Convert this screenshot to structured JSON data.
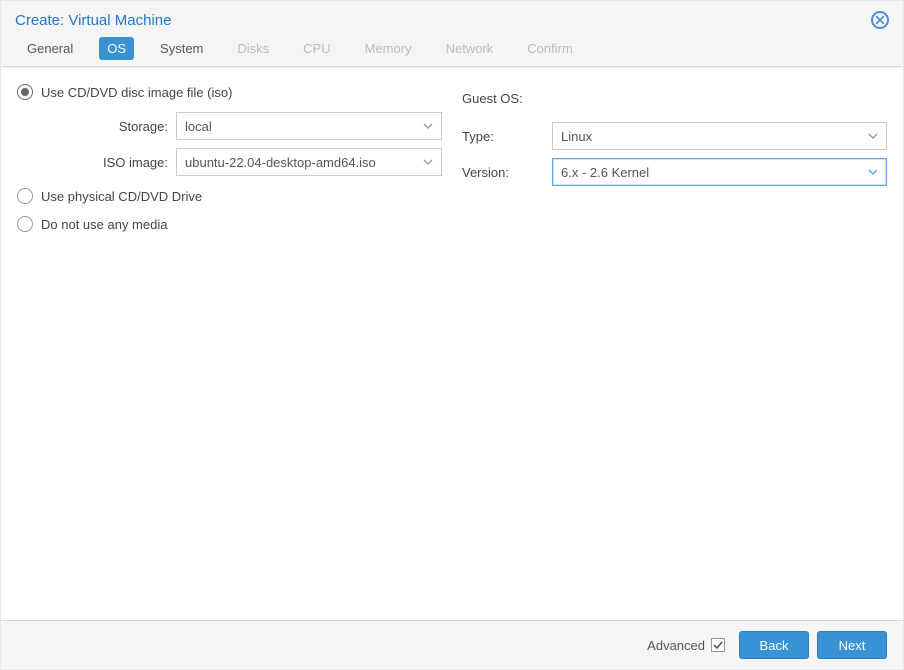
{
  "title": "Create: Virtual Machine",
  "tabs": [
    {
      "label": "General",
      "state": "enabled"
    },
    {
      "label": "OS",
      "state": "active"
    },
    {
      "label": "System",
      "state": "enabled"
    },
    {
      "label": "Disks",
      "state": "disabled"
    },
    {
      "label": "CPU",
      "state": "disabled"
    },
    {
      "label": "Memory",
      "state": "disabled"
    },
    {
      "label": "Network",
      "state": "disabled"
    },
    {
      "label": "Confirm",
      "state": "disabled"
    }
  ],
  "media": {
    "radios": {
      "iso": "Use CD/DVD disc image file (iso)",
      "physical": "Use physical CD/DVD Drive",
      "none": "Do not use any media"
    },
    "selected": "iso",
    "storage_label": "Storage:",
    "storage_value": "local",
    "iso_label": "ISO image:",
    "iso_value": "ubuntu-22.04-desktop-amd64.iso"
  },
  "guest_os": {
    "heading": "Guest OS:",
    "type_label": "Type:",
    "type_value": "Linux",
    "version_label": "Version:",
    "version_value": "6.x - 2.6 Kernel"
  },
  "footer": {
    "advanced_label": "Advanced",
    "advanced_checked": true,
    "back": "Back",
    "next": "Next"
  }
}
